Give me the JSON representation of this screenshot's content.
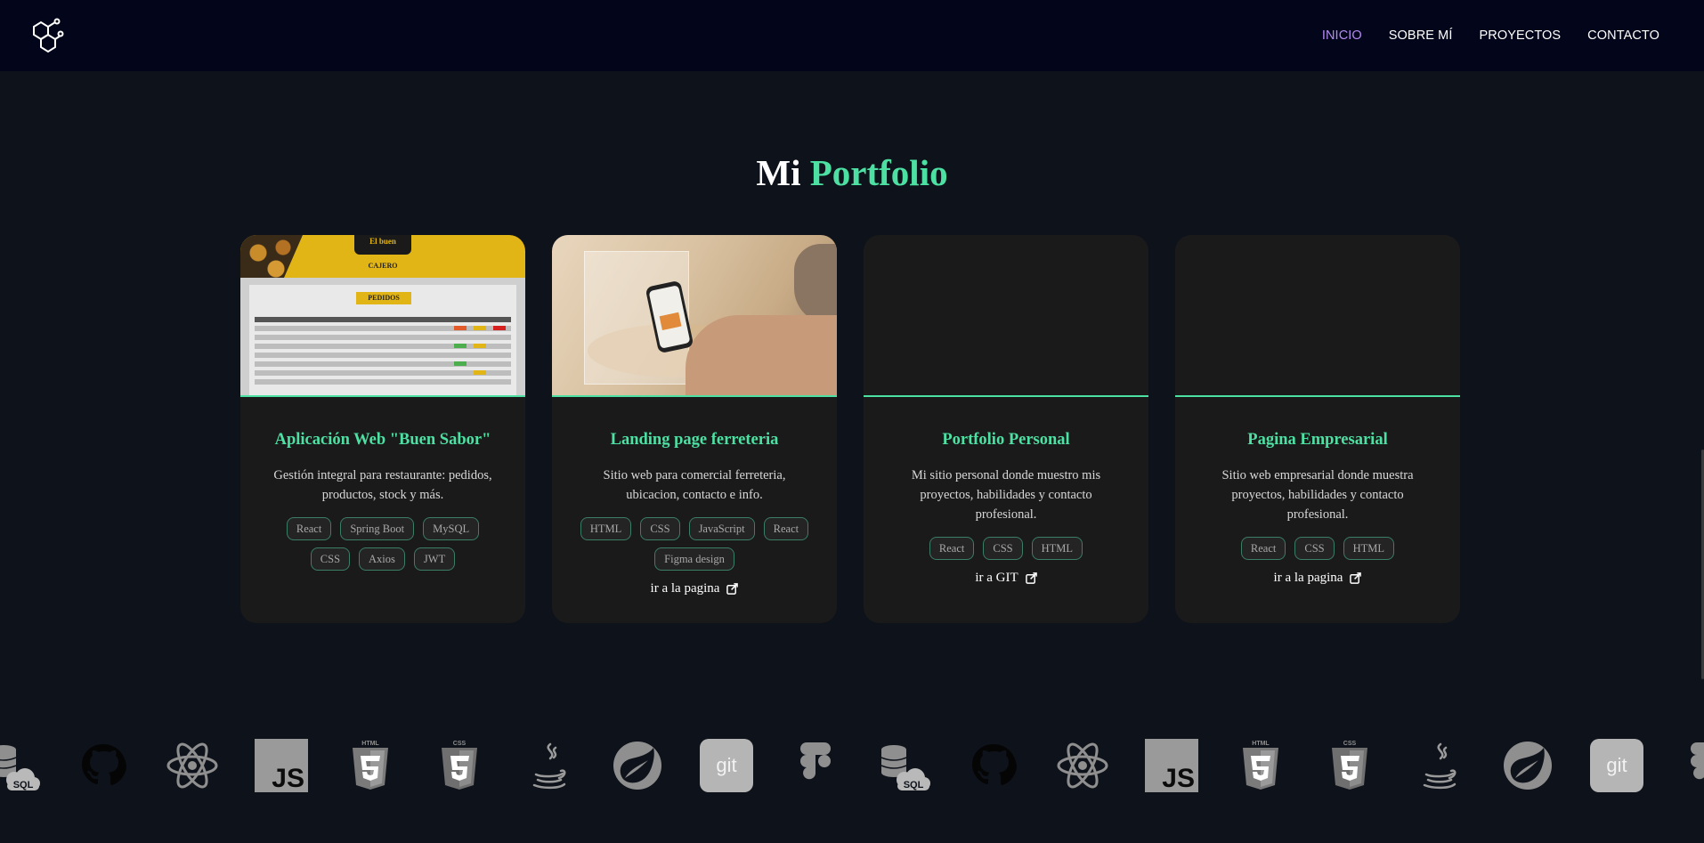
{
  "nav": {
    "links": [
      "INICIO",
      "SOBRE MÍ",
      "PROYECTOS",
      "CONTACTO"
    ]
  },
  "section": {
    "title_prefix": "Mi",
    "title_accent": "Portfolio"
  },
  "colors": {
    "background": "#0e121a",
    "navbar": "#03061b",
    "accent": "#4de0a3",
    "nav_active": "#b48bf2",
    "card": "#1a1a1a"
  },
  "thumbnail_text": {
    "brand": "El buen",
    "role": "CAJERO",
    "panel_title": "PEDIDOS"
  },
  "projects": [
    {
      "title": "Aplicación Web \"Buen Sabor\"",
      "description": "Gestión integral para restaurante: pedidos, productos, stock y más.",
      "tags": [
        "React",
        "Spring Boot",
        "MySQL",
        "CSS",
        "Axios",
        "JWT"
      ],
      "link": ""
    },
    {
      "title": "Landing page ferreteria",
      "description": "Sitio web para comercial ferreteria, ubicacion, contacto e info.",
      "tags": [
        "HTML",
        "CSS",
        "JavaScript",
        "React",
        "Figma design"
      ],
      "link": "ir a la pagina"
    },
    {
      "title": "Portfolio Personal",
      "description": "Mi sitio personal donde muestro mis proyectos, habilidades y contacto profesional.",
      "tags": [
        "React",
        "CSS",
        "HTML"
      ],
      "link": "ir a GIT"
    },
    {
      "title": "Pagina Empresarial",
      "description": "Sitio web empresarial donde muestra proyectos, habilidades y contacto profesional.",
      "tags": [
        "React",
        "CSS",
        "HTML"
      ],
      "link": "ir a la pagina"
    }
  ],
  "skills": {
    "icons": [
      "sql-icon",
      "github-icon",
      "react-icon",
      "javascript-icon",
      "html5-icon",
      "css3-icon",
      "java-icon",
      "spring-icon",
      "git-icon",
      "figma-icon",
      "sql-icon",
      "github-icon",
      "react-icon",
      "javascript-icon",
      "html5-icon",
      "css3-icon",
      "java-icon",
      "spring-icon",
      "git-icon",
      "figma-icon"
    ],
    "labels": {
      "sql": "SQL",
      "javascript": "JS",
      "html5": "HTML",
      "css3": "CSS",
      "git": "git"
    }
  }
}
